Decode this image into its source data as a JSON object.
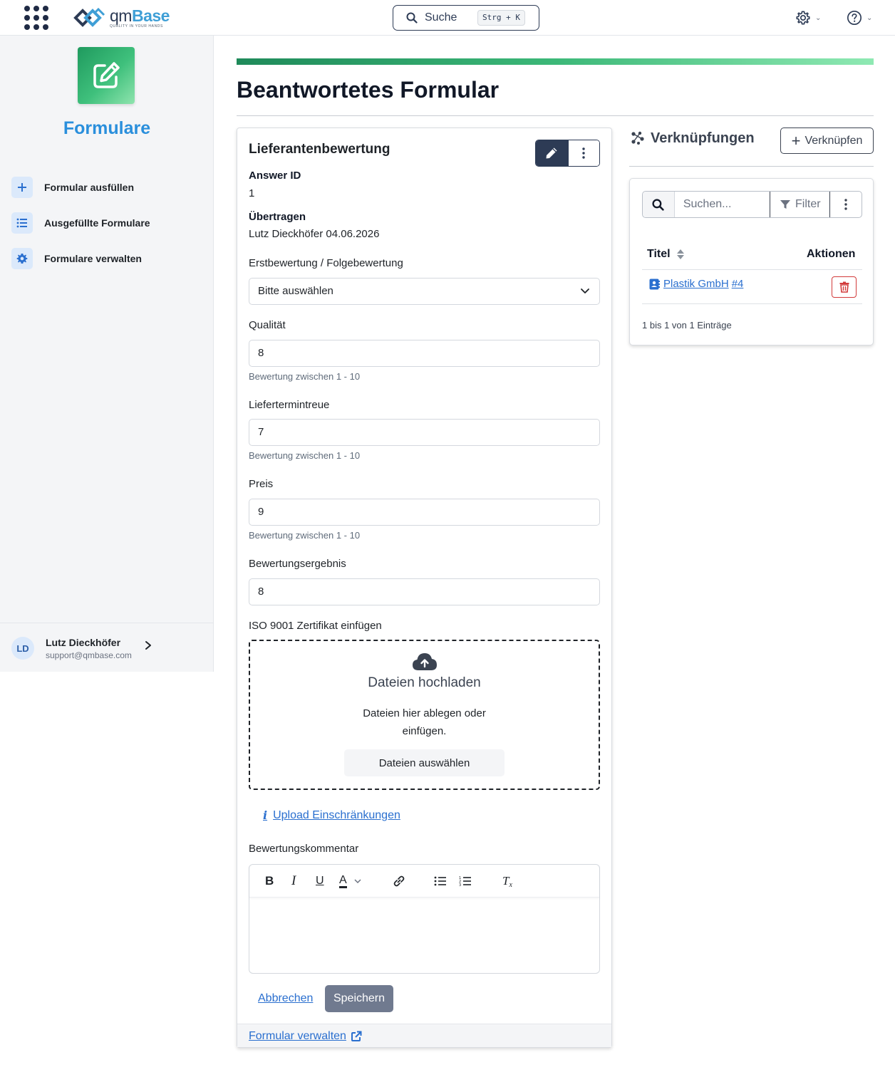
{
  "header": {
    "logo_name_qm": "qm",
    "logo_name_base": "Base",
    "logo_tagline": "QUALITY IN YOUR HANDS",
    "search_label": "Suche",
    "search_shortcut": "Strg + K",
    "icons": [
      "apps-grid-icon",
      "search-icon",
      "settings-gear-icon",
      "help-circle-icon",
      "chevron-down-icon"
    ]
  },
  "sidebar": {
    "module_title": "Formulare",
    "module_icon": "pencil-square-icon",
    "items": [
      {
        "label": "Formular ausfüllen",
        "icon": "plus-icon"
      },
      {
        "label": "Ausgefüllte Formulare",
        "icon": "list-icon"
      },
      {
        "label": "Formulare verwalten",
        "icon": "gear-icon"
      }
    ],
    "user": {
      "initials": "LD",
      "name": "Lutz Dieckhöfer",
      "email": "support@qmbase.com"
    }
  },
  "main": {
    "page_title": "Beantwortetes Formular",
    "form": {
      "title": "Lieferantenbewertung",
      "answer_id_label": "Answer ID",
      "answer_id_value": "1",
      "submitted_label": "Übertragen",
      "submitted_value": "Lutz Dieckhöfer 04.06.2026",
      "fields": {
        "erstbewertung": {
          "label": "Erstbewertung / Folgebewertung",
          "value": "Bitte auswählen"
        },
        "qualitaet": {
          "label": "Qualität",
          "value": "8",
          "hint": "Bewertung zwischen 1 - 10"
        },
        "liefertermintreue": {
          "label": "Liefertermintreue",
          "value": "7",
          "hint": "Bewertung zwischen 1 - 10"
        },
        "preis": {
          "label": "Preis",
          "value": "9",
          "hint": "Bewertung zwischen 1 - 10"
        },
        "ergebnis": {
          "label": "Bewertungsergebnis",
          "value": "8"
        },
        "zertifikat": {
          "label": "ISO 9001 Zertifikat einfügen"
        },
        "kommentar": {
          "label": "Bewertungskommentar"
        }
      },
      "dropzone": {
        "title": "Dateien hochladen",
        "text_line1": "Dateien hier ablegen oder",
        "text_line2": "einfügen.",
        "button": "Dateien auswählen"
      },
      "upload_restrictions_link": " Upload Einschränkungen",
      "editor_toolbar": [
        "bold",
        "italic",
        "underline",
        "text-color",
        "link",
        "bullet-list",
        "numbered-list",
        "clear-format"
      ],
      "cancel_label": "Abbrechen",
      "save_label": "Speichern",
      "manage_link": "Formular verwalten"
    },
    "links": {
      "title": "Verknüpfungen",
      "add_button": "Verknüpfen",
      "search_placeholder": "Suchen...",
      "filter_label": "Filter",
      "col_title": "Titel",
      "col_actions": "Aktionen",
      "rows": [
        {
          "title": "Plastik GmbH",
          "suffix": "#4"
        }
      ],
      "info": "1 bis 1 von 1 Einträge"
    }
  },
  "colors": {
    "accent": "#2a8fdc",
    "navy": "#2d3b55",
    "link": "#2a6fcf",
    "danger": "#d23b3b",
    "green": "#3cb878"
  }
}
